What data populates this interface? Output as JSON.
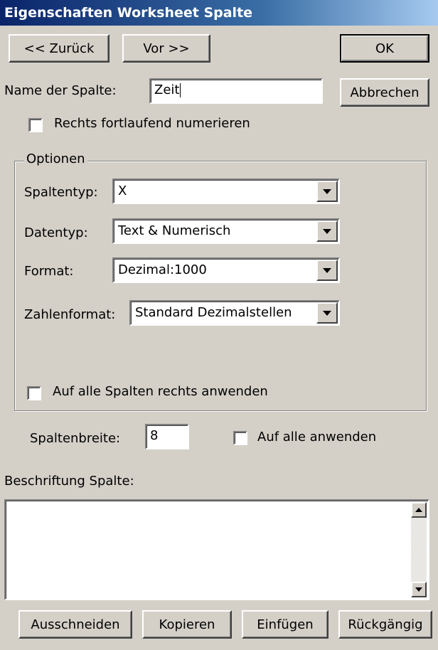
{
  "window": {
    "title": "Eigenschaften Worksheet Spalte"
  },
  "nav": {
    "back_label": "<< Zurück",
    "forward_label": "Vor >>"
  },
  "actions": {
    "ok_label": "OK",
    "cancel_label": "Abbrechen"
  },
  "column_name": {
    "label": "Name der Spalte:",
    "value": "Zeit"
  },
  "number_right": {
    "label": "Rechts fortlaufend numerieren",
    "checked": false
  },
  "options": {
    "legend": "Optionen",
    "column_type": {
      "label": "Spaltentyp:",
      "value": "X"
    },
    "data_type": {
      "label": "Datentyp:",
      "value": "Text & Numerisch"
    },
    "format": {
      "label": "Format:",
      "value": "Dezimal:1000"
    },
    "number_format": {
      "label": "Zahlenformat:",
      "value": "Standard Dezimalstellen"
    },
    "apply_all_right": {
      "label": "Auf alle Spalten rechts anwenden",
      "checked": false
    }
  },
  "width": {
    "label": "Spaltenbreite:",
    "value": "8",
    "apply_all_label": "Auf alle anwenden",
    "apply_all_checked": false
  },
  "caption": {
    "label": "Beschriftung Spalte:",
    "value": ""
  },
  "edit": {
    "cut_label": "Ausschneiden",
    "copy_label": "Kopieren",
    "paste_label": "Einfügen",
    "undo_label": "Rückgängig"
  },
  "colors": {
    "titlebar_start": "#0a246a",
    "titlebar_end": "#a6caf0",
    "face": "#d4d0c8"
  }
}
